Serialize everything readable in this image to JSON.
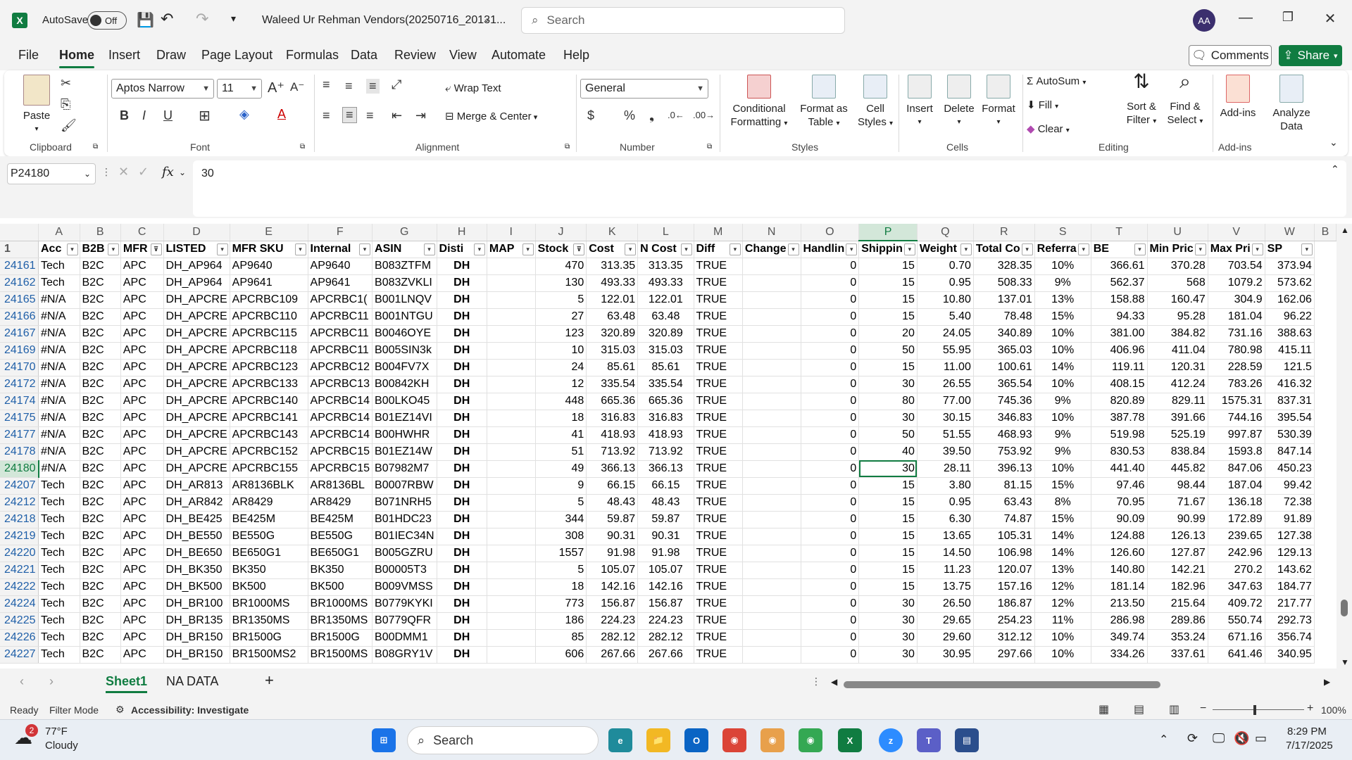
{
  "app": {
    "autosave_label": "AutoSave",
    "autosave_state": "Off",
    "file_title": "Waleed Ur Rehman Vendors(20250716_20131...",
    "search_placeholder": "Search",
    "user_initials": "AA"
  },
  "menu": {
    "tabs": [
      "File",
      "Home",
      "Insert",
      "Draw",
      "Page Layout",
      "Formulas",
      "Data",
      "Review",
      "View",
      "Automate",
      "Help"
    ],
    "active": "Home",
    "comments_label": "Comments",
    "share_label": "Share"
  },
  "ribbon": {
    "clipboard": {
      "paste": "Paste",
      "label": "Clipboard"
    },
    "font": {
      "name": "Aptos Narrow",
      "size": "11",
      "label": "Font"
    },
    "alignment": {
      "wrap": "Wrap Text",
      "merge": "Merge & Center",
      "label": "Alignment"
    },
    "number": {
      "format": "General",
      "label": "Number"
    },
    "styles": {
      "conditional": "Conditional",
      "conditional2": "Formatting",
      "format_table": "Format as",
      "format_table2": "Table",
      "cell_styles": "Cell",
      "cell_styles2": "Styles",
      "label": "Styles"
    },
    "cells": {
      "insert": "Insert",
      "delete": "Delete",
      "format": "Format",
      "label": "Cells"
    },
    "editing": {
      "autosum": "AutoSum",
      "fill": "Fill",
      "clear": "Clear",
      "sort": "Sort &",
      "sort2": "Filter",
      "find": "Find &",
      "find2": "Select",
      "label": "Editing"
    },
    "addins": {
      "addins": "Add-ins",
      "label": "Add-ins"
    },
    "analyze": {
      "l1": "Analyze",
      "l2": "Data"
    }
  },
  "formula_bar": {
    "name_box": "P24180",
    "value": "30",
    "fx": "fx"
  },
  "grid": {
    "columns": [
      "A",
      "B",
      "C",
      "D",
      "E",
      "F",
      "G",
      "H",
      "I",
      "J",
      "K",
      "L",
      "M",
      "N",
      "O",
      "P",
      "Q",
      "R",
      "S",
      "T",
      "U",
      "V",
      "W",
      "B"
    ],
    "header_row_num": "1",
    "headers": [
      "Acc",
      "B2B",
      "MFR",
      "LISTED",
      "MFR SKU",
      "Internal",
      "ASIN",
      "Disti",
      "MAP",
      "Stock",
      "Cost",
      "N Cost",
      "Diff",
      "Change",
      "Handlin",
      "Shippin",
      "Weight",
      "Total Co",
      "Referra",
      "BE",
      "Min Pric",
      "Max Pri",
      "SP"
    ],
    "rows": [
      [
        "24161",
        "Tech",
        "B2C",
        "APC",
        "DH_AP964",
        "AP9640",
        "AP9640",
        "B083ZTFM",
        "DH",
        "",
        "470",
        "313.35",
        "313.35",
        "TRUE",
        "",
        "0",
        "15",
        "0.70",
        "328.35",
        "10%",
        "366.61",
        "370.28",
        "703.54",
        "373.94"
      ],
      [
        "24162",
        "Tech",
        "B2C",
        "APC",
        "DH_AP964",
        "AP9641",
        "AP9641",
        "B083ZVKLI",
        "DH",
        "",
        "130",
        "493.33",
        "493.33",
        "TRUE",
        "",
        "0",
        "15",
        "0.95",
        "508.33",
        "9%",
        "562.37",
        "568",
        "1079.2",
        "573.62"
      ],
      [
        "24165",
        "#N/A",
        "B2C",
        "APC",
        "DH_APCRE",
        "APCRBC109",
        "APCRBC1(",
        "B001LNQV",
        "DH",
        "",
        "5",
        "122.01",
        "122.01",
        "TRUE",
        "",
        "0",
        "15",
        "10.80",
        "137.01",
        "13%",
        "158.88",
        "160.47",
        "304.9",
        "162.06"
      ],
      [
        "24166",
        "#N/A",
        "B2C",
        "APC",
        "DH_APCRE",
        "APCRBC110",
        "APCRBC11",
        "B001NTGU",
        "DH",
        "",
        "27",
        "63.48",
        "63.48",
        "TRUE",
        "",
        "0",
        "15",
        "5.40",
        "78.48",
        "15%",
        "94.33",
        "95.28",
        "181.04",
        "96.22"
      ],
      [
        "24167",
        "#N/A",
        "B2C",
        "APC",
        "DH_APCRE",
        "APCRBC115",
        "APCRBC11",
        "B0046OYE",
        "DH",
        "",
        "123",
        "320.89",
        "320.89",
        "TRUE",
        "",
        "0",
        "20",
        "24.05",
        "340.89",
        "10%",
        "381.00",
        "384.82",
        "731.16",
        "388.63"
      ],
      [
        "24169",
        "#N/A",
        "B2C",
        "APC",
        "DH_APCRE",
        "APCRBC118",
        "APCRBC11",
        "B005SIN3k",
        "DH",
        "",
        "10",
        "315.03",
        "315.03",
        "TRUE",
        "",
        "0",
        "50",
        "55.95",
        "365.03",
        "10%",
        "406.96",
        "411.04",
        "780.98",
        "415.11"
      ],
      [
        "24170",
        "#N/A",
        "B2C",
        "APC",
        "DH_APCRE",
        "APCRBC123",
        "APCRBC12",
        "B004FV7X",
        "DH",
        "",
        "24",
        "85.61",
        "85.61",
        "TRUE",
        "",
        "0",
        "15",
        "11.00",
        "100.61",
        "14%",
        "119.11",
        "120.31",
        "228.59",
        "121.5"
      ],
      [
        "24172",
        "#N/A",
        "B2C",
        "APC",
        "DH_APCRE",
        "APCRBC133",
        "APCRBC13",
        "B00842KH",
        "DH",
        "",
        "12",
        "335.54",
        "335.54",
        "TRUE",
        "",
        "0",
        "30",
        "26.55",
        "365.54",
        "10%",
        "408.15",
        "412.24",
        "783.26",
        "416.32"
      ],
      [
        "24174",
        "#N/A",
        "B2C",
        "APC",
        "DH_APCRE",
        "APCRBC140",
        "APCRBC14",
        "B00LKO45",
        "DH",
        "",
        "448",
        "665.36",
        "665.36",
        "TRUE",
        "",
        "0",
        "80",
        "77.00",
        "745.36",
        "9%",
        "820.89",
        "829.11",
        "1575.31",
        "837.31"
      ],
      [
        "24175",
        "#N/A",
        "B2C",
        "APC",
        "DH_APCRE",
        "APCRBC141",
        "APCRBC14",
        "B01EZ14VI",
        "DH",
        "",
        "18",
        "316.83",
        "316.83",
        "TRUE",
        "",
        "0",
        "30",
        "30.15",
        "346.83",
        "10%",
        "387.78",
        "391.66",
        "744.16",
        "395.54"
      ],
      [
        "24177",
        "#N/A",
        "B2C",
        "APC",
        "DH_APCRE",
        "APCRBC143",
        "APCRBC14",
        "B00HWHR",
        "DH",
        "",
        "41",
        "418.93",
        "418.93",
        "TRUE",
        "",
        "0",
        "50",
        "51.55",
        "468.93",
        "9%",
        "519.98",
        "525.19",
        "997.87",
        "530.39"
      ],
      [
        "24178",
        "#N/A",
        "B2C",
        "APC",
        "DH_APCRE",
        "APCRBC152",
        "APCRBC15",
        "B01EZ14W",
        "DH",
        "",
        "51",
        "713.92",
        "713.92",
        "TRUE",
        "",
        "0",
        "40",
        "39.50",
        "753.92",
        "9%",
        "830.53",
        "838.84",
        "1593.8",
        "847.14"
      ],
      [
        "24180",
        "#N/A",
        "B2C",
        "APC",
        "DH_APCRE",
        "APCRBC155",
        "APCRBC15",
        "B07982M7",
        "DH",
        "",
        "49",
        "366.13",
        "366.13",
        "TRUE",
        "",
        "0",
        "30",
        "28.11",
        "396.13",
        "10%",
        "441.40",
        "445.82",
        "847.06",
        "450.23"
      ],
      [
        "24207",
        "Tech",
        "B2C",
        "APC",
        "DH_AR813",
        "AR8136BLK",
        "AR8136BL",
        "B0007RBW",
        "DH",
        "",
        "9",
        "66.15",
        "66.15",
        "TRUE",
        "",
        "0",
        "15",
        "3.80",
        "81.15",
        "15%",
        "97.46",
        "98.44",
        "187.04",
        "99.42"
      ],
      [
        "24212",
        "Tech",
        "B2C",
        "APC",
        "DH_AR842",
        "AR8429",
        "AR8429",
        "B071NRH5",
        "DH",
        "",
        "5",
        "48.43",
        "48.43",
        "TRUE",
        "",
        "0",
        "15",
        "0.95",
        "63.43",
        "8%",
        "70.95",
        "71.67",
        "136.18",
        "72.38"
      ],
      [
        "24218",
        "Tech",
        "B2C",
        "APC",
        "DH_BE425",
        "BE425M",
        "BE425M",
        "B01HDC23",
        "DH",
        "",
        "344",
        "59.87",
        "59.87",
        "TRUE",
        "",
        "0",
        "15",
        "6.30",
        "74.87",
        "15%",
        "90.09",
        "90.99",
        "172.89",
        "91.89"
      ],
      [
        "24219",
        "Tech",
        "B2C",
        "APC",
        "DH_BE550",
        "BE550G",
        "BE550G",
        "B01IEC34N",
        "DH",
        "",
        "308",
        "90.31",
        "90.31",
        "TRUE",
        "",
        "0",
        "15",
        "13.65",
        "105.31",
        "14%",
        "124.88",
        "126.13",
        "239.65",
        "127.38"
      ],
      [
        "24220",
        "Tech",
        "B2C",
        "APC",
        "DH_BE650",
        "BE650G1",
        "BE650G1",
        "B005GZRU",
        "DH",
        "",
        "1557",
        "91.98",
        "91.98",
        "TRUE",
        "",
        "0",
        "15",
        "14.50",
        "106.98",
        "14%",
        "126.60",
        "127.87",
        "242.96",
        "129.13"
      ],
      [
        "24221",
        "Tech",
        "B2C",
        "APC",
        "DH_BK350",
        "BK350",
        "BK350",
        "B00005T3",
        "DH",
        "",
        "5",
        "105.07",
        "105.07",
        "TRUE",
        "",
        "0",
        "15",
        "11.23",
        "120.07",
        "13%",
        "140.80",
        "142.21",
        "270.2",
        "143.62"
      ],
      [
        "24222",
        "Tech",
        "B2C",
        "APC",
        "DH_BK500",
        "BK500",
        "BK500",
        "B009VMSS",
        "DH",
        "",
        "18",
        "142.16",
        "142.16",
        "TRUE",
        "",
        "0",
        "15",
        "13.75",
        "157.16",
        "12%",
        "181.14",
        "182.96",
        "347.63",
        "184.77"
      ],
      [
        "24224",
        "Tech",
        "B2C",
        "APC",
        "DH_BR100",
        "BR1000MS",
        "BR1000MS",
        "B0779KYKI",
        "DH",
        "",
        "773",
        "156.87",
        "156.87",
        "TRUE",
        "",
        "0",
        "30",
        "26.50",
        "186.87",
        "12%",
        "213.50",
        "215.64",
        "409.72",
        "217.77"
      ],
      [
        "24225",
        "Tech",
        "B2C",
        "APC",
        "DH_BR135",
        "BR1350MS",
        "BR1350MS",
        "B0779QFR",
        "DH",
        "",
        "186",
        "224.23",
        "224.23",
        "TRUE",
        "",
        "0",
        "30",
        "29.65",
        "254.23",
        "11%",
        "286.98",
        "289.86",
        "550.74",
        "292.73"
      ],
      [
        "24226",
        "Tech",
        "B2C",
        "APC",
        "DH_BR150",
        "BR1500G",
        "BR1500G",
        "B00DMM1",
        "DH",
        "",
        "85",
        "282.12",
        "282.12",
        "TRUE",
        "",
        "0",
        "30",
        "29.60",
        "312.12",
        "10%",
        "349.74",
        "353.24",
        "671.16",
        "356.74"
      ],
      [
        "24227",
        "Tech",
        "B2C",
        "APC",
        "DH_BR150",
        "BR1500MS2",
        "BR1500MS",
        "B08GRY1V",
        "DH",
        "",
        "606",
        "267.66",
        "267.66",
        "TRUE",
        "",
        "0",
        "30",
        "30.95",
        "297.66",
        "10%",
        "334.26",
        "337.61",
        "641.46",
        "340.95"
      ]
    ],
    "active_row": "24180"
  },
  "sheets": {
    "tabs": [
      "Sheet1",
      "NA DATA"
    ],
    "active": "Sheet1",
    "add": "+"
  },
  "status": {
    "ready": "Ready",
    "filter": "Filter Mode",
    "accessibility": "Accessibility: Investigate",
    "zoom": "100%"
  },
  "taskbar": {
    "weather_temp": "77°F",
    "weather_desc": "Cloudy",
    "search": "Search",
    "time": "8:29 PM",
    "date": "7/17/2025",
    "badge": "2"
  }
}
